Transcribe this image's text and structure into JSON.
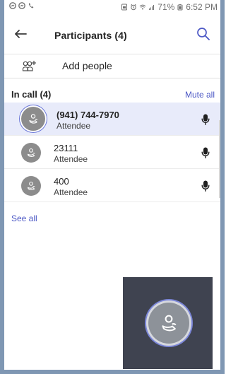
{
  "status_bar": {
    "battery_percent": "71%",
    "time": "6:52 PM"
  },
  "header": {
    "title": "Participants (4)"
  },
  "actions": {
    "add_people": "Add people"
  },
  "in_call": {
    "label": "In call (4)",
    "mute_all": "Mute all",
    "participants": [
      {
        "name": "(941) 744-7970",
        "role": "Attendee",
        "selected": true
      },
      {
        "name": "23111",
        "role": "Attendee",
        "selected": false
      },
      {
        "name": "400",
        "role": "Attendee",
        "selected": false
      }
    ]
  },
  "footer": {
    "see_all": "See all"
  },
  "colors": {
    "accent": "#4c58c5",
    "selected_row": "#e8ebfa",
    "avatar_gray": "#8c8c8c",
    "thumbnail_bg": "#3f4350"
  },
  "icons": {
    "status_left": [
      "messenger-icon",
      "messenger-icon",
      "phone-icon"
    ],
    "status_right": [
      "sim-icon",
      "alarm-icon",
      "wifi-icon",
      "signal-icon",
      "battery-icon"
    ],
    "header": [
      "back-arrow-icon",
      "search-icon"
    ],
    "rows": [
      "person-phone-icon",
      "microphone-icon"
    ]
  }
}
